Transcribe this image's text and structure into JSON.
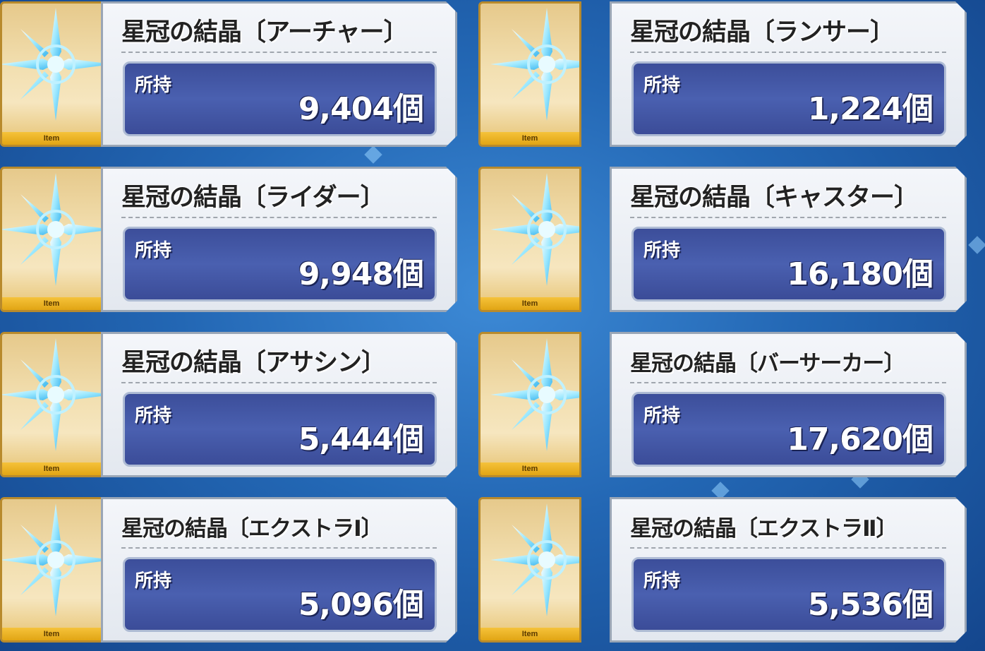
{
  "item_tag": "Item",
  "owned_label": "所持",
  "items": [
    {
      "name": "星冠の結晶〔アーチャー〕",
      "count": "9,404個",
      "icon": "archer-bow-crystal-icon"
    },
    {
      "name": "星冠の結晶〔ランサー〕",
      "count": "1,224個",
      "icon": "lancer-spear-crystal-icon"
    },
    {
      "name": "星冠の結晶〔ライダー〕",
      "count": "9,948個",
      "icon": "rider-dragon-crystal-icon"
    },
    {
      "name": "星冠の結晶〔キャスター〕",
      "count": "16,180個",
      "icon": "caster-staff-crystal-icon"
    },
    {
      "name": "星冠の結晶〔アサシン〕",
      "count": "5,444個",
      "icon": "assassin-skull-crystal-icon"
    },
    {
      "name": "星冠の結晶〔バーサーカー〕",
      "count": "17,620個",
      "icon": "berserker-beast-crystal-icon"
    },
    {
      "name": "星冠の結晶〔エクストラⅠ〕",
      "count": "5,096個",
      "icon": "extra-one-crystal-icon"
    },
    {
      "name": "星冠の結晶〔エクストラⅡ〕",
      "count": "5,536個",
      "icon": "extra-two-crystal-icon"
    }
  ],
  "colors": {
    "background": "#2367b4",
    "count_bar": "#4a60b0",
    "thumb_gold": "#e6c270",
    "crystal": "#8fe3ff"
  }
}
